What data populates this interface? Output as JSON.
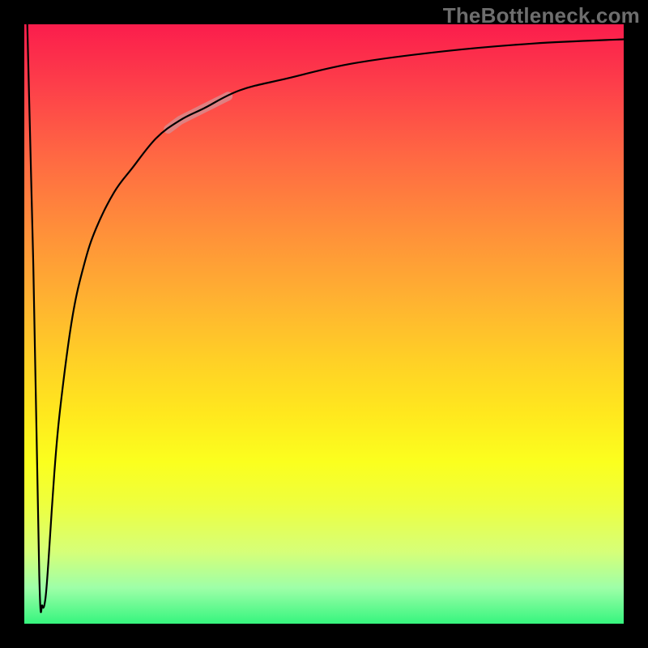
{
  "watermark": "TheBottleneck.com",
  "colors": {
    "frame": "#000000",
    "curve": "#000000",
    "highlight": "#d98a8c",
    "gradient_top": "#fb1d4c",
    "gradient_bottom": "#36f57e"
  },
  "chart_data": {
    "type": "line",
    "title": "",
    "xlabel": "",
    "ylabel": "",
    "xlim": [
      0,
      100
    ],
    "ylim": [
      0,
      100
    ],
    "grid": false,
    "legend": false,
    "description": "Bottleneck-style curve: sharp spike/dip near x≈0 followed by asymptotic rise toward y≈100. Y increases upward (100 at top near red, 0 at bottom near green).",
    "series": [
      {
        "name": "bottleneck-curve",
        "x": [
          0.5,
          1.5,
          2.5,
          3,
          3.5,
          4,
          5,
          6,
          8,
          10,
          12,
          15,
          18,
          22,
          26,
          30,
          36,
          44,
          55,
          70,
          85,
          100
        ],
        "y": [
          100,
          60,
          8,
          3,
          4,
          10,
          25,
          36,
          51,
          60,
          66,
          72,
          76,
          81,
          84,
          86,
          89,
          91,
          93.5,
          95.5,
          96.8,
          97.5
        ]
      }
    ],
    "highlight_segment": {
      "series": "bottleneck-curve",
      "x_range": [
        24,
        34
      ],
      "note": "pale pink emphasis band on curve"
    }
  }
}
